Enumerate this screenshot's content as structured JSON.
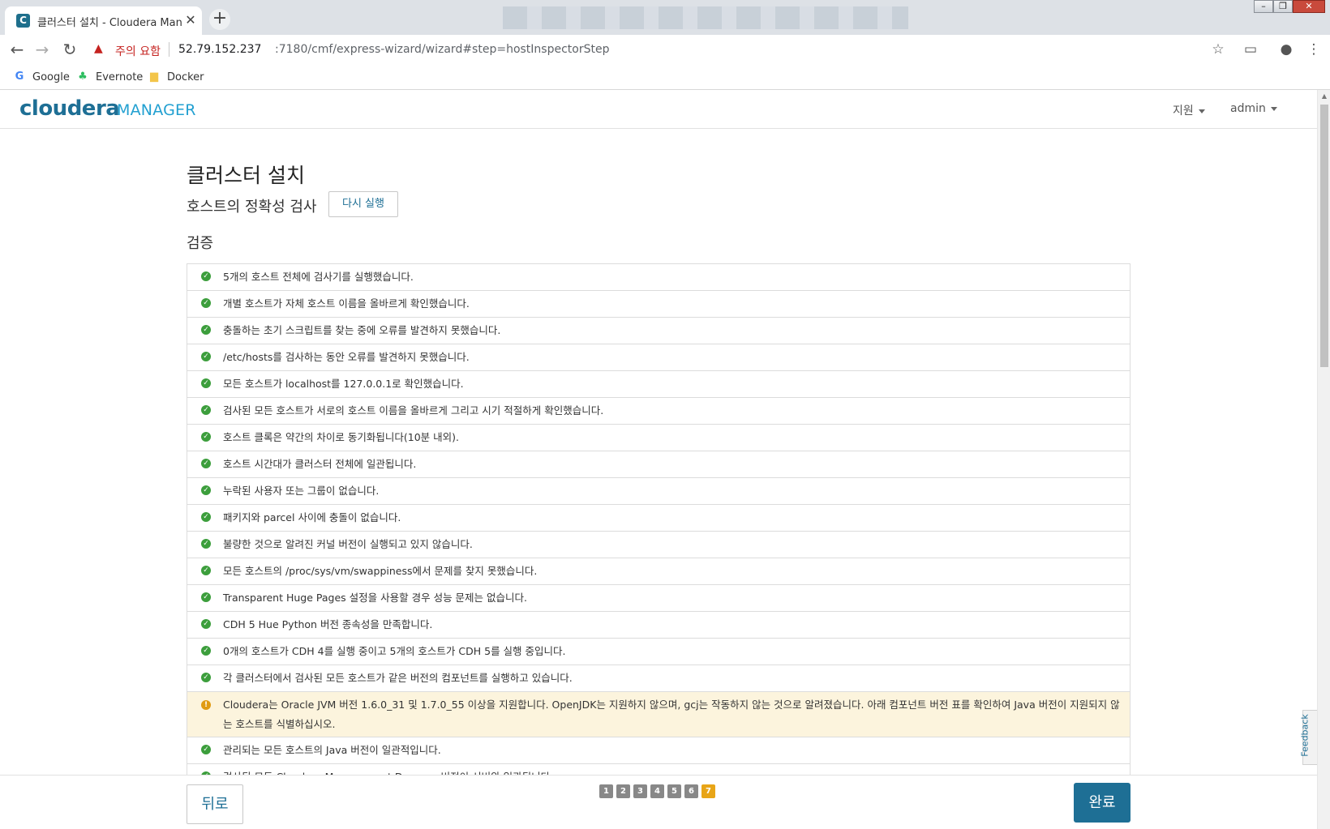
{
  "browser": {
    "tab_title": "클러스터 설치 - Cloudera Mana",
    "tab_favicon": "C",
    "close_glyph": "✕",
    "newtab_glyph": "+",
    "security_warning": "주의 요함",
    "security_glyph": "▲",
    "url_host": "52.79.152.237",
    "url_path": ":7180/cmf/express-wizard/wizard#step=hostInspectorStep",
    "win_minimize": "–",
    "win_maximize": "❐",
    "win_close": "✕",
    "icons": {
      "back": "←",
      "forward": "→",
      "reload": "↻",
      "star": "☆",
      "cast": "▭",
      "profile": "●",
      "menu": "⋮"
    },
    "bookmarks": [
      {
        "label": "Google",
        "icon": "G",
        "color": "#4285f4"
      },
      {
        "label": "Evernote",
        "icon": "♣",
        "color": "#2dbe60"
      },
      {
        "label": "Docker",
        "icon": "▆",
        "color": "#f3c54a"
      }
    ]
  },
  "header": {
    "logo_main": "cloudera",
    "logo_product": "MANAGER",
    "support_menu": "지원",
    "user_menu": "admin"
  },
  "main": {
    "page_title": "클러스터 설치",
    "section_title": "호스트의 정확성 검사",
    "rerun_button": "다시 실행",
    "validation_title": "검증",
    "checks": [
      {
        "status": "ok",
        "text": "5개의 호스트 전체에 검사기를 실행했습니다."
      },
      {
        "status": "ok",
        "text": "개별 호스트가 자체 호스트 이름을 올바르게 확인했습니다."
      },
      {
        "status": "ok",
        "text": "충돌하는 초기 스크립트를 찾는 중에 오류를 발견하지 못했습니다."
      },
      {
        "status": "ok",
        "text": "/etc/hosts를 검사하는 동안 오류를 발견하지 못했습니다."
      },
      {
        "status": "ok",
        "text": "모든 호스트가 localhost를 127.0.0.1로 확인했습니다."
      },
      {
        "status": "ok",
        "text": "검사된 모든 호스트가 서로의 호스트 이름을 올바르게 그리고 시기 적절하게 확인했습니다."
      },
      {
        "status": "ok",
        "text": "호스트 클록은 약간의 차이로 동기화됩니다(10분 내외)."
      },
      {
        "status": "ok",
        "text": "호스트 시간대가 클러스터 전체에 일관됩니다."
      },
      {
        "status": "ok",
        "text": "누락된 사용자 또는 그룹이 없습니다."
      },
      {
        "status": "ok",
        "text": "패키지와 parcel 사이에 충돌이 없습니다."
      },
      {
        "status": "ok",
        "text": "불량한 것으로 알려진 커널 버전이 실행되고 있지 않습니다."
      },
      {
        "status": "ok",
        "text": "모든 호스트의 /proc/sys/vm/swappiness에서 문제를 찾지 못했습니다."
      },
      {
        "status": "ok",
        "text": "Transparent Huge Pages 설정을 사용할 경우 성능 문제는 없습니다."
      },
      {
        "status": "ok",
        "text": "CDH 5 Hue Python 버전 종속성을 만족합니다."
      },
      {
        "status": "ok",
        "text": "0개의 호스트가 CDH 4를 실행 중이고 5개의 호스트가 CDH 5를 실행 중입니다."
      },
      {
        "status": "ok",
        "text": "각 클러스터에서 검사된 모든 호스트가 같은 버전의 컴포넌트를 실행하고 있습니다."
      },
      {
        "status": "warn",
        "text": "Cloudera는 Oracle JVM 버전 1.6.0_31 및 1.7.0_55 이상을 지원합니다. OpenJDK는 지원하지 않으며, gcj는 작동하지 않는 것으로 알려졌습니다. 아래 컴포넌트 버전 표를 확인하여 Java 버전이 지원되지 않는 호스트를 식별하십시오."
      },
      {
        "status": "ok",
        "text": "관리되는 모든 호스트의 Java 버전이 일관적입니다."
      },
      {
        "status": "ok",
        "text": "검사된 모든 Cloudera Management Daemon 버전이 서버와 일관됩니다."
      }
    ],
    "ok_glyph": "✓",
    "warn_glyph": "!"
  },
  "footer": {
    "back_button": "뒤로",
    "finish_button": "완료",
    "steps": [
      "1",
      "2",
      "3",
      "4",
      "5",
      "6",
      "7"
    ],
    "current_step": "7"
  },
  "feedback_tab": "Feedback",
  "colors": {
    "brand": "#1e6f95",
    "ok": "#3c9e3c",
    "warn": "#e09b12",
    "warn_bg": "#fcf4dd",
    "active_step": "#e8a517"
  }
}
